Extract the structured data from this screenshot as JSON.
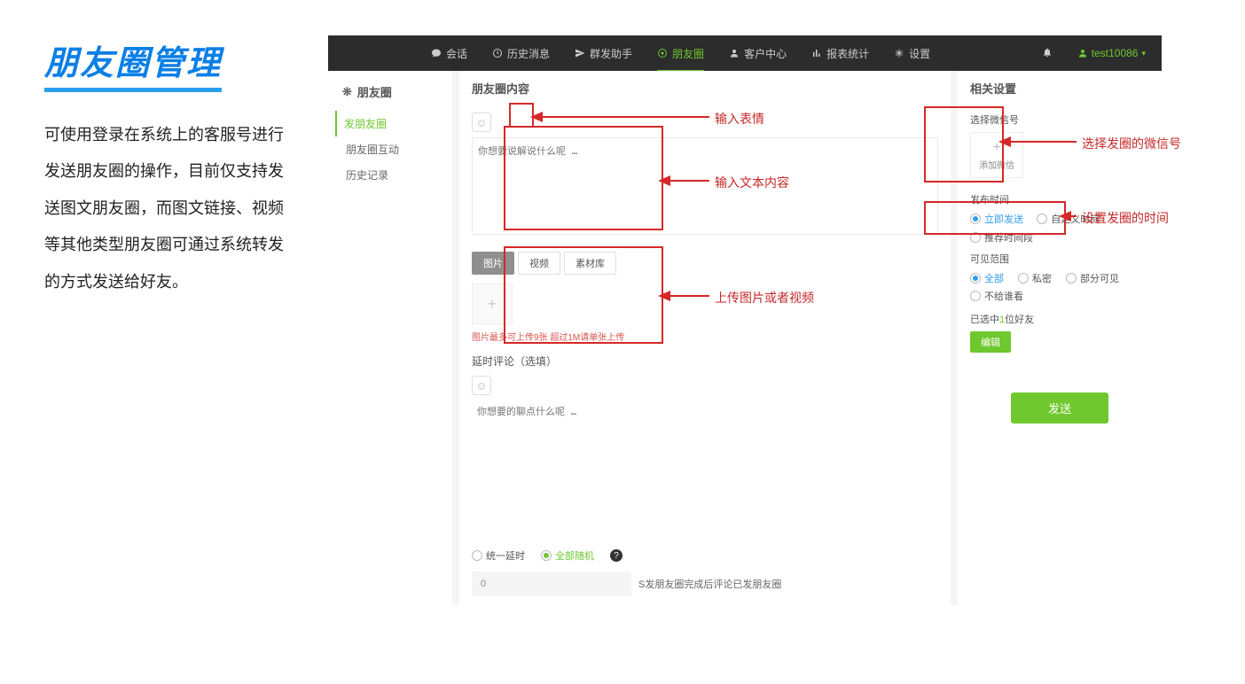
{
  "slide": {
    "title": "朋友圈管理",
    "description": "可使用登录在系统上的客服号进行发送朋友圈的操作，目前仅支持发送图文朋友圈，而图文链接、视频等其他类型朋友圈可通过系统转发的方式发送给好友。"
  },
  "nav": {
    "items": [
      "会话",
      "历史消息",
      "群发助手",
      "朋友圈",
      "客户中心",
      "报表统计",
      "设置"
    ],
    "activeIndex": 3,
    "user": "test10086"
  },
  "sidebar": {
    "header": "朋友圈",
    "items": [
      "发朋友圈",
      "朋友圈互动",
      "历史记录"
    ],
    "activeIndex": 0
  },
  "main": {
    "title": "朋友圈内容",
    "textarea_placeholder": "你想要说解说什么呢 …",
    "media_tabs": [
      "图片",
      "视频",
      "素材库"
    ],
    "img_hint": "图片最多可上传9张 超过1M请单张上传",
    "delay_comment_title": "延时评论（选填）",
    "delay_comment_placeholder": "你想要的聊点什么呢 …",
    "delay_mode": {
      "uniform": "统一延时",
      "random": "全部随机"
    },
    "delay_input_value": "0",
    "delay_suffix": "S发朋友圈完成后评论已发朋友圈"
  },
  "right": {
    "title": "相关设置",
    "select_wx_label": "选择微信号",
    "add_wx": "添加微信",
    "publish_time_label": "发布时间",
    "time_options": {
      "immediate": "立即发送",
      "custom": "自定义时间",
      "recommend": "推荐时间段"
    },
    "visible_label": "可见范围",
    "visible_options": {
      "all": "全部",
      "private": "私密",
      "partial": "部分可见",
      "exclude": "不给谁看"
    },
    "selected_prefix": "已选中",
    "selected_count": "1",
    "selected_suffix": "位好友",
    "edit_label": "编辑",
    "send_label": "发送"
  },
  "annotations": {
    "emoji": "输入表情",
    "text": "输入文本内容",
    "upload": "上传图片或者视频",
    "select_wx": "选择发圈的微信号",
    "set_time": "设置发圈的时间"
  }
}
